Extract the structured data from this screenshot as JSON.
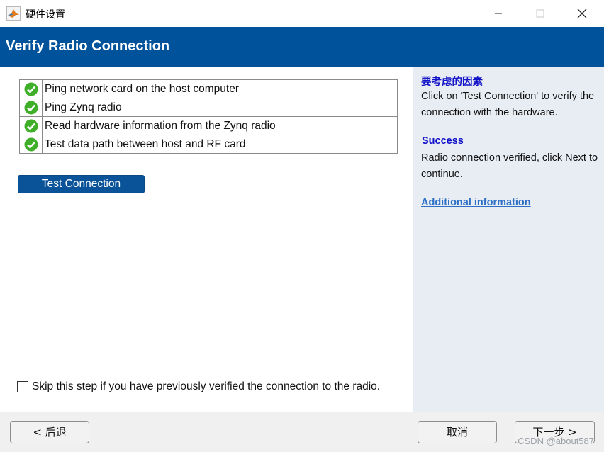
{
  "window": {
    "title": "硬件设置"
  },
  "header": {
    "title": "Verify Radio Connection"
  },
  "steps": [
    {
      "label": "Ping network card on the host computer",
      "status": "success"
    },
    {
      "label": "Ping Zynq radio",
      "status": "success"
    },
    {
      "label": "Read hardware information from the Zynq radio",
      "status": "success"
    },
    {
      "label": "Test data path between host and RF card",
      "status": "success"
    }
  ],
  "test_button": {
    "label": "Test Connection"
  },
  "skip": {
    "label": "Skip this step if you have previously verified the connection to the radio.",
    "checked": false
  },
  "right_panel": {
    "consider_heading": "要考虑的因素",
    "consider_text": "Click on 'Test Connection' to verify the connection with the hardware.",
    "success_heading": "Success",
    "success_text": "Radio connection verified, click Next to continue.",
    "link": "Additional information"
  },
  "footer": {
    "back_label": "< 后退",
    "cancel_label": "取消",
    "next_label": "下一步 >",
    "watermark": "CSDN @about587"
  },
  "colors": {
    "header": "#00539b",
    "accent_button": "#0a5398",
    "heading_text": "#1212c8",
    "link": "#2c6fc5",
    "success_icon": "#3fae29"
  }
}
